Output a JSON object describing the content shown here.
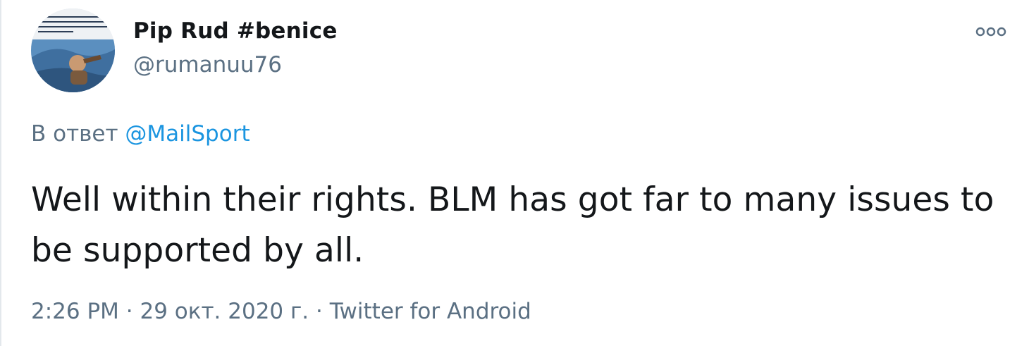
{
  "author": {
    "display_name": "Pip Rud #benice",
    "handle": "@rumanuu76",
    "avatar_icon": "user-avatar-icon"
  },
  "reply": {
    "prefix": "В ответ",
    "mention": "@MailSport"
  },
  "tweet": {
    "text": "Well within their rights. BLM has got far to many issues to be supported by all."
  },
  "meta": {
    "time": "2:26 PM",
    "separator1": "·",
    "date": "29 окт. 2020 г.",
    "separator2": "·",
    "source": "Twitter for Android"
  },
  "icons": {
    "more": "more-options-icon"
  },
  "colors": {
    "text_primary": "#14171a",
    "text_secondary": "#5b7083",
    "link": "#1b95e0"
  }
}
